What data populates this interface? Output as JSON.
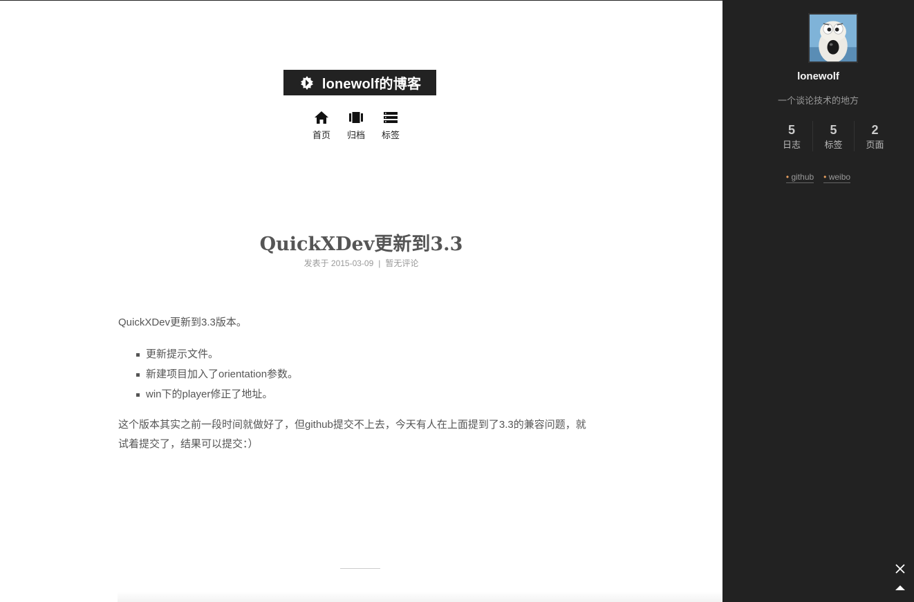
{
  "brand": {
    "title": "lonewolf的博客",
    "icon": "brand-logo-icon"
  },
  "nav": {
    "items": [
      {
        "label": "首页",
        "icon": "home-icon"
      },
      {
        "label": "归档",
        "icon": "archive-icon"
      },
      {
        "label": "标签",
        "icon": "tags-icon"
      }
    ]
  },
  "post": {
    "title": "QuickXDev更新到3.3",
    "meta": {
      "posted_label": "发表于 2015-03-09",
      "separator": "|",
      "comments": "暂无评论"
    },
    "intro": "QuickXDev更新到3.3版本。",
    "list": [
      "更新提示文件。",
      "新建项目加入了orientation参数。",
      "win下的player修正了地址。"
    ],
    "outro": "这个版本其实之前一段时间就做好了，但github提交不上去，今天有人在上面提到了3.3的兼容问题，就试着提交了，结果可以提交：）"
  },
  "sidebar": {
    "author": "lonewolf",
    "description": "一个谈论技术的地方",
    "stats": [
      {
        "count": "5",
        "label": "日志"
      },
      {
        "count": "5",
        "label": "标签"
      },
      {
        "count": "2",
        "label": "页面"
      }
    ],
    "links": [
      "github",
      "weibo"
    ]
  },
  "colors": {
    "sidebar_bg": "#222222",
    "brand_bg": "#222222",
    "link_dot": "#e8a060"
  }
}
